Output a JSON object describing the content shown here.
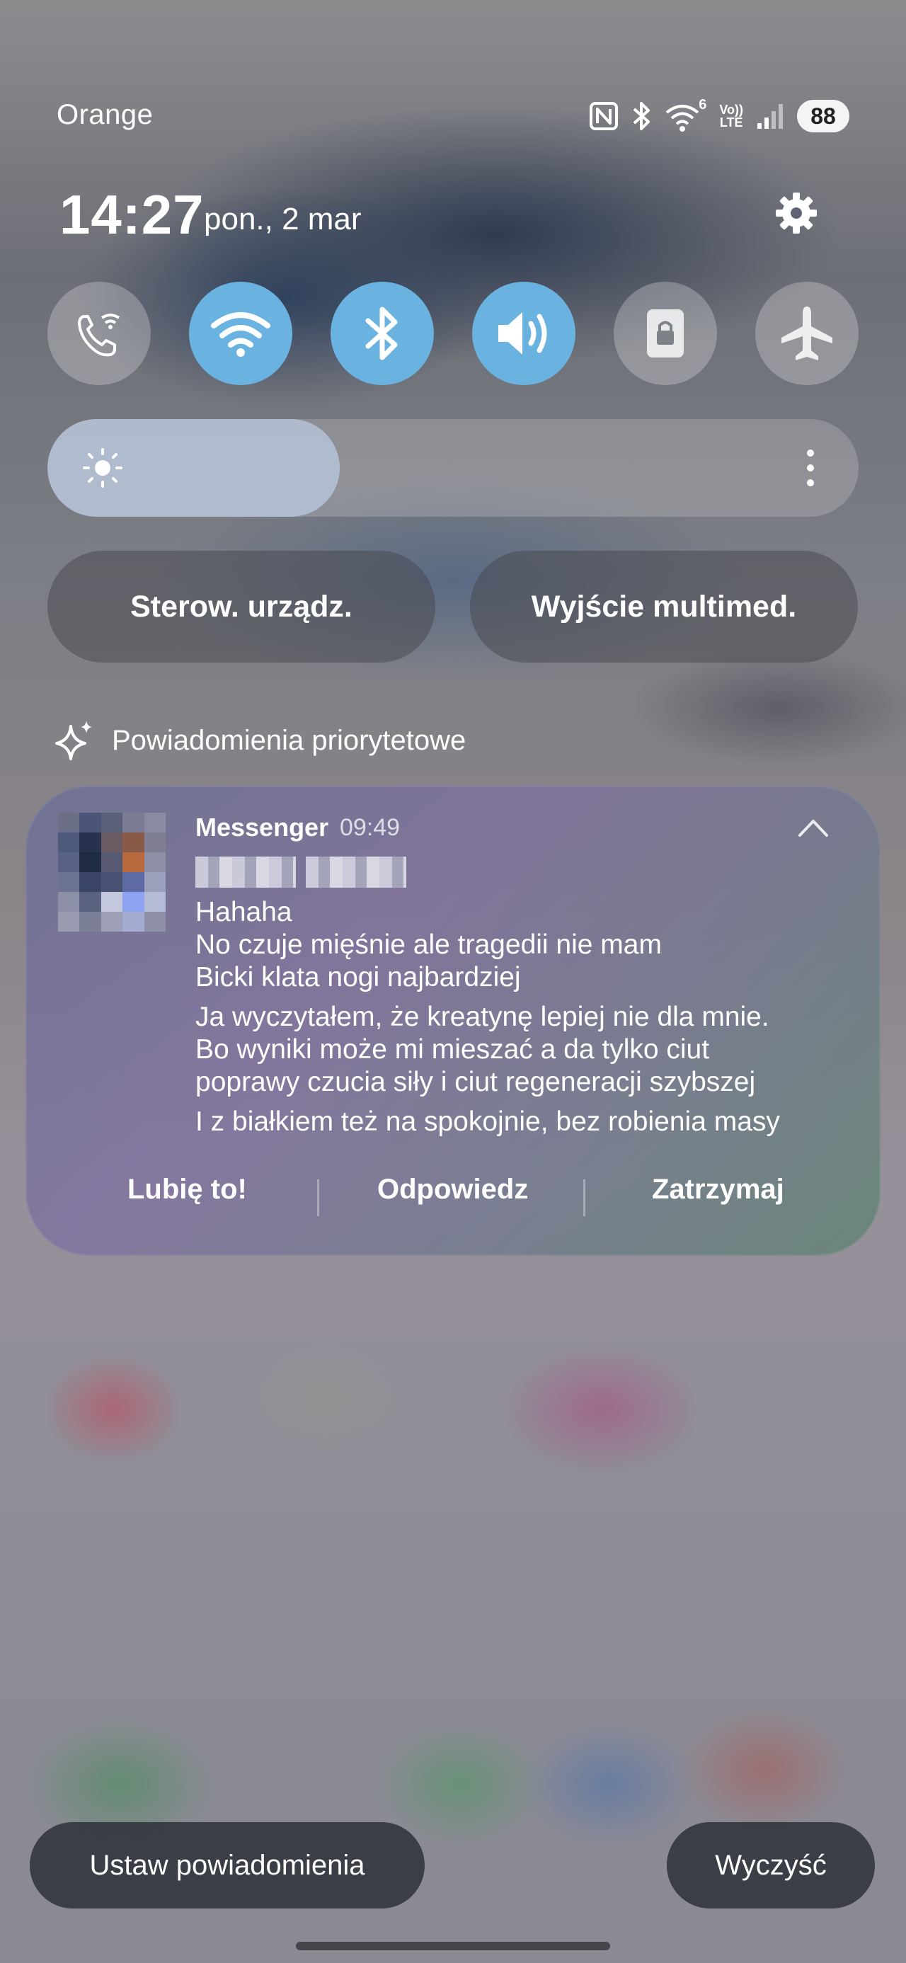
{
  "status_bar": {
    "carrier": "Orange",
    "volte_top": "Vo))",
    "volte_bottom": "LTE",
    "wifi_badge": "6",
    "battery": "88",
    "icons": [
      "nfc-icon",
      "bluetooth-icon",
      "wifi-icon",
      "volte-icon",
      "signal-icon",
      "battery-icon"
    ]
  },
  "header": {
    "time": "14:27",
    "date": "pon., 2 mar"
  },
  "quick_tiles": [
    {
      "icon": "wifi-calling-icon",
      "on": false
    },
    {
      "icon": "wifi-icon",
      "on": true
    },
    {
      "icon": "bluetooth-icon",
      "on": true
    },
    {
      "icon": "sound-icon",
      "on": true
    },
    {
      "icon": "lock-icon",
      "on": false
    },
    {
      "icon": "airplane-icon",
      "on": false
    }
  ],
  "brightness": {
    "level": 0.36
  },
  "shortcuts": {
    "device_control": "Sterow. urządz.",
    "media_output": "Wyjście multimed."
  },
  "priority": {
    "label": "Powiadomienia priorytetowe"
  },
  "notification": {
    "app": "Messenger",
    "time": "09:49",
    "lines": [
      "Hahaha",
      "No czuje mięśnie ale tragedii nie mam",
      "Bicki klata nogi najbardziej",
      "Ja wyczytałem, że kreatynę lepiej nie dla mnie.",
      "Bo wyniki może mi mieszać a da tylko ciut",
      "poprawy czucia siły i ciut regeneracji szybszej",
      "I z białkiem też na spokojnie, bez robienia masy"
    ],
    "actions": {
      "like": "Lubię to!",
      "reply": "Odpowiedz",
      "mute": "Zatrzymaj"
    }
  },
  "footer": {
    "settings": "Ustaw powiadomienia",
    "clear": "Wyczyść"
  },
  "colors": {
    "tile_on": "#6ab2e0"
  }
}
